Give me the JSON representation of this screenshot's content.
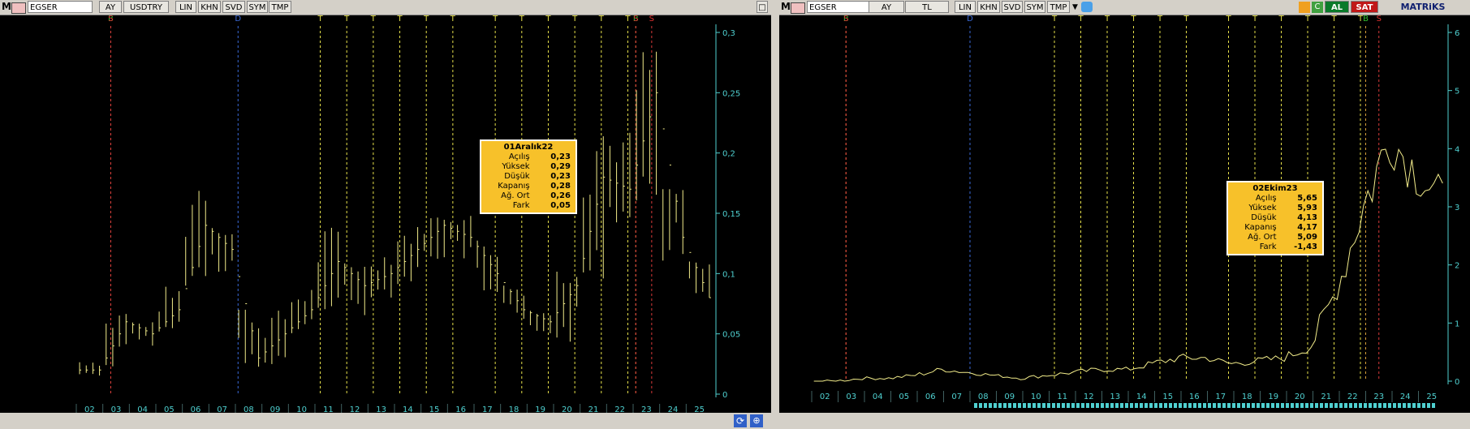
{
  "left": {
    "toolbar": {
      "logo": "M",
      "symbol": "EGSER",
      "buttons": [
        "AY",
        "USDTRY",
        "LIN",
        "KHN",
        "SVD",
        "SYM",
        "TMP"
      ]
    },
    "close_glyph": "□",
    "tooltip": {
      "title": "01Aralık22",
      "rows": [
        {
          "label": "Açılış",
          "value": "0,23"
        },
        {
          "label": "Yüksek",
          "value": "0,29"
        },
        {
          "label": "Düşük",
          "value": "0,23"
        },
        {
          "label": "Kapanış",
          "value": "0,28"
        },
        {
          "label": "Ağ. Ort",
          "value": "0,26"
        },
        {
          "label": "Fark",
          "value": "0,05"
        }
      ]
    },
    "colors": {
      "bars": "#f2ec8a",
      "axis": "#4fd0d0",
      "signal_yellow": "#e6e04a",
      "signal_blue": "#3a6ad8"
    }
  },
  "right": {
    "toolbar": {
      "logo": "M",
      "symbol": "EGSER",
      "buttons": [
        "AY",
        "TL",
        "LIN",
        "KHN",
        "SVD",
        "SYM",
        "TMP"
      ],
      "al_label": "AL",
      "sat_label": "SAT",
      "brand": "MATRiKS"
    },
    "tooltip": {
      "title": "02Ekim23",
      "rows": [
        {
          "label": "Açılış",
          "value": "5,65"
        },
        {
          "label": "Yüksek",
          "value": "5,93"
        },
        {
          "label": "Düşük",
          "value": "4,13"
        },
        {
          "label": "Kapanış",
          "value": "4,17"
        },
        {
          "label": "Ağ. Ort",
          "value": "5,09"
        },
        {
          "label": "Fark",
          "value": "-1,43"
        }
      ]
    }
  },
  "chart_data": [
    {
      "type": "bar",
      "x": [
        "02",
        "03",
        "04",
        "05",
        "06",
        "07",
        "08",
        "09",
        "10",
        "11",
        "12",
        "13",
        "14",
        "15",
        "16",
        "17",
        "18",
        "19",
        "20",
        "21",
        "22",
        "23",
        "24",
        "25"
      ],
      "yticks": [
        "0",
        "0,05",
        "0,1",
        "0,15",
        "0,2",
        "0,25",
        "0,3"
      ],
      "ylim": [
        0,
        0.3
      ],
      "signal_markers": [
        "B",
        "S",
        "D",
        "T",
        "T",
        "T",
        "T",
        "T",
        "T",
        "T",
        "T",
        "T",
        "T",
        "T",
        "T",
        "B",
        "S",
        "S"
      ],
      "monthly_close": [
        0.02,
        0.06,
        0.05,
        0.07,
        0.14,
        0.12,
        0.03,
        0.05,
        0.07,
        0.11,
        0.09,
        0.1,
        0.12,
        0.14,
        0.13,
        0.1,
        0.07,
        0.06,
        0.09,
        0.18,
        0.17,
        0.25,
        0.13,
        0.08
      ],
      "monthly_high": [
        0.03,
        0.07,
        0.06,
        0.09,
        0.19,
        0.14,
        0.07,
        0.07,
        0.09,
        0.14,
        0.11,
        0.12,
        0.14,
        0.15,
        0.15,
        0.13,
        0.09,
        0.07,
        0.11,
        0.23,
        0.22,
        0.29,
        0.17,
        0.11
      ],
      "monthly_low": [
        0.015,
        0.02,
        0.04,
        0.05,
        0.09,
        0.1,
        0.01,
        0.02,
        0.05,
        0.07,
        0.06,
        0.08,
        0.09,
        0.11,
        0.11,
        0.07,
        0.05,
        0.05,
        0.04,
        0.09,
        0.14,
        0.16,
        0.11,
        0.08
      ]
    },
    {
      "type": "line",
      "x": [
        "02",
        "03",
        "04",
        "05",
        "06",
        "07",
        "08",
        "09",
        "10",
        "11",
        "12",
        "13",
        "14",
        "15",
        "16",
        "17",
        "18",
        "19",
        "20",
        "21",
        "22",
        "23",
        "24",
        "25"
      ],
      "yticks": [
        "0",
        "1",
        "2",
        "3",
        "4",
        "5",
        "6"
      ],
      "ylim": [
        0,
        6
      ],
      "signal_markers": [
        "B",
        "S",
        "D",
        "T",
        "T",
        "T",
        "T",
        "T",
        "T",
        "T",
        "T",
        "T",
        "T",
        "T",
        "T",
        "B",
        "S"
      ],
      "monthly_close": [
        0.0,
        0.05,
        0.05,
        0.1,
        0.2,
        0.15,
        0.1,
        0.05,
        0.1,
        0.15,
        0.2,
        0.2,
        0.3,
        0.4,
        0.4,
        0.3,
        0.35,
        0.4,
        0.6,
        1.6,
        3.0,
        4.2,
        3.6,
        3.1
      ]
    }
  ]
}
